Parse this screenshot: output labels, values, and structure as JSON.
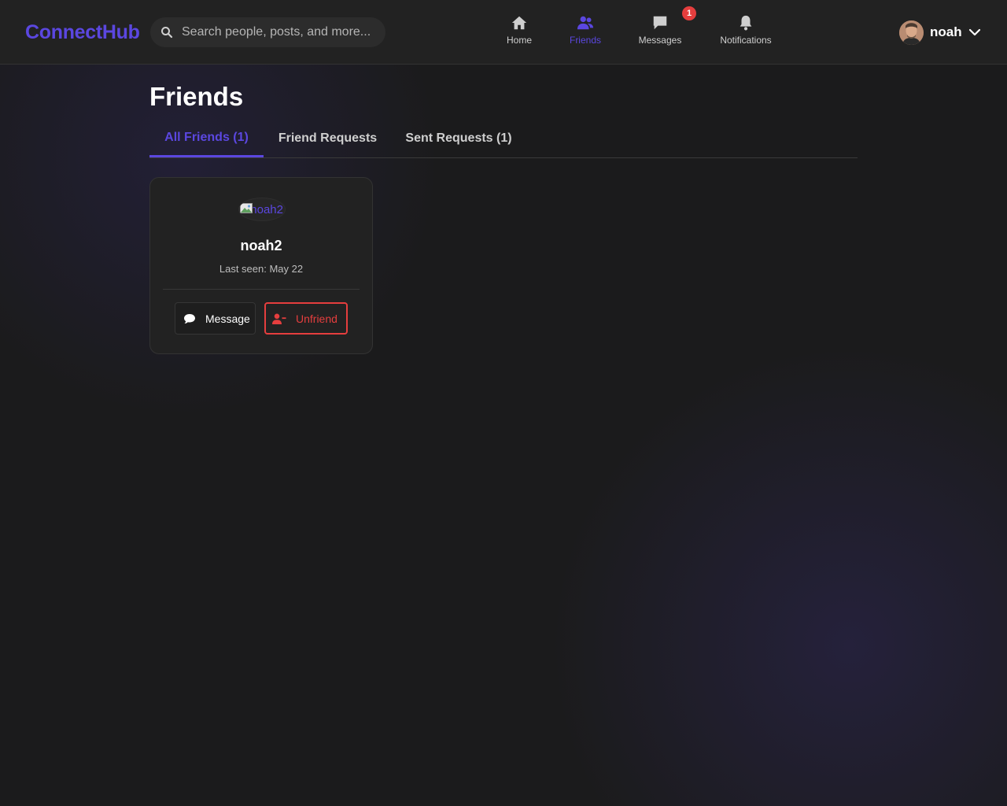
{
  "app": {
    "logo": "ConnectHub",
    "accent_color": "#5b47e0",
    "danger_color": "#e53e3e"
  },
  "search": {
    "placeholder": "Search people, posts, and more..."
  },
  "nav": {
    "home": "Home",
    "friends": "Friends",
    "messages": "Messages",
    "notifications": "Notifications",
    "messages_badge": "1",
    "active": "friends"
  },
  "user": {
    "name": "noah"
  },
  "page": {
    "title": "Friends",
    "tabs": [
      {
        "label": "All Friends (1)",
        "active": true
      },
      {
        "label": "Friend Requests",
        "active": false
      },
      {
        "label": "Sent Requests (1)",
        "active": false
      }
    ]
  },
  "friends": [
    {
      "avatar_alt": "noah2",
      "name": "noah2",
      "last_seen": "Last seen: May 22",
      "message_label": "Message",
      "unfriend_label": "Unfriend"
    }
  ]
}
